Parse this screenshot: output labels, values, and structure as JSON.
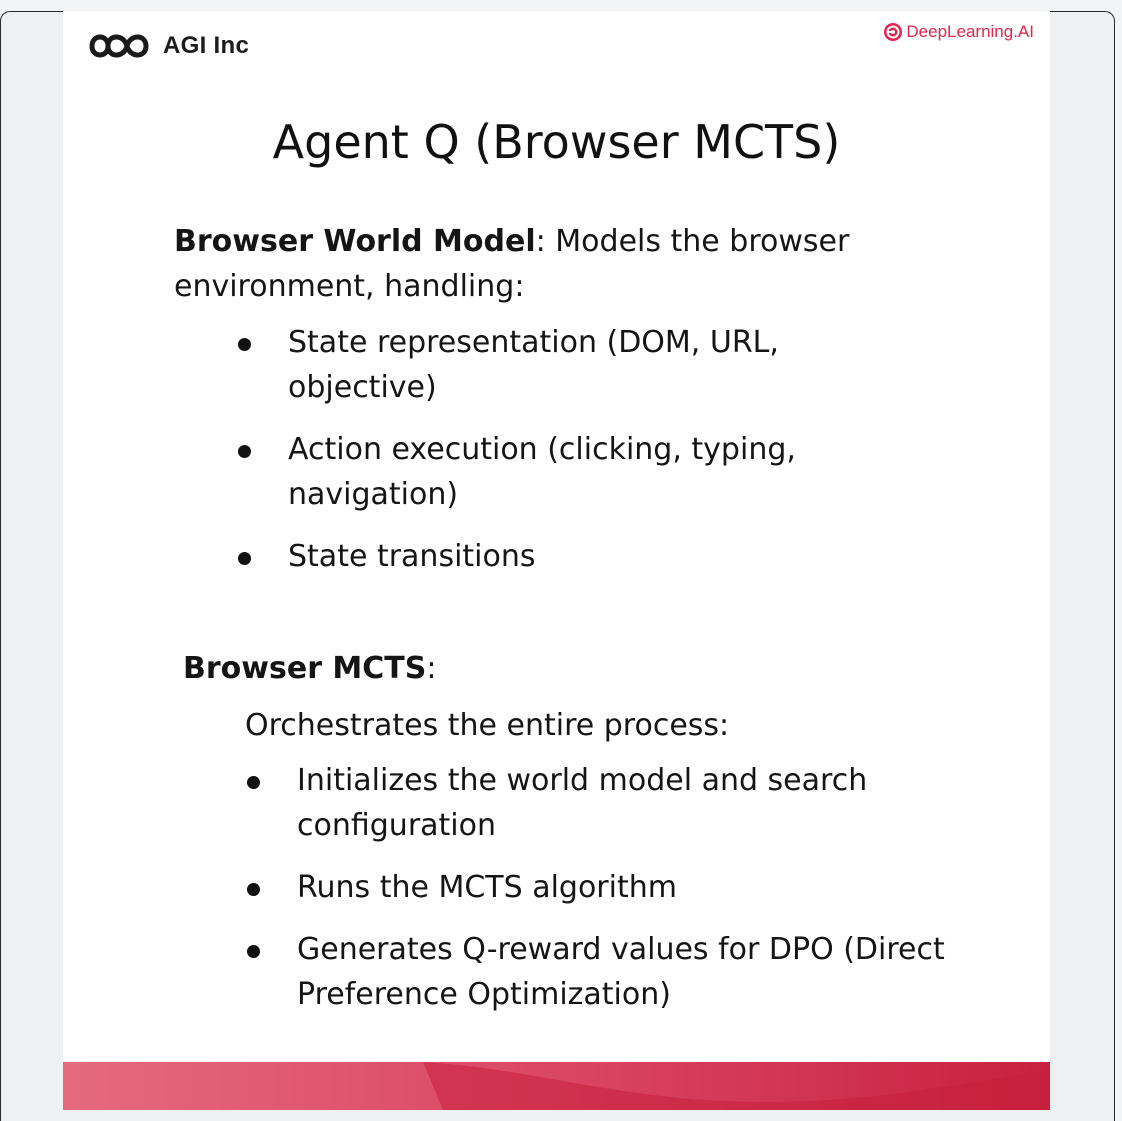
{
  "header": {
    "left_logo_text": "AGI Inc",
    "right_logo_text": "DeepLearning.AI"
  },
  "title": "Agent Q (Browser MCTS)",
  "section1": {
    "heading_bold": "Browser World Model",
    "heading_rest": ": Models the browser environment, handling:",
    "bullets": [
      "State representation (DOM, URL, objective)",
      "Action execution (clicking, typing, navigation)",
      "State transitions"
    ]
  },
  "section2": {
    "heading_bold": "Browser MCTS",
    "heading_rest": ":",
    "intro": "Orchestrates the entire process:",
    "bullets": [
      "Initializes the world model and search configuration",
      "Runs the MCTS algorithm",
      "Generates Q-reward values for DPO (Direct Preference Optimization)"
    ]
  },
  "colors": {
    "brand_red": "#e0264e",
    "footer_left": "#e56a7d",
    "footer_right": "#c8213f"
  },
  "icons": {
    "agi_logo": "infinity-icon",
    "deeplearning_logo": "deeplearning-logo-icon",
    "bullet": "bullet-dot-icon"
  }
}
